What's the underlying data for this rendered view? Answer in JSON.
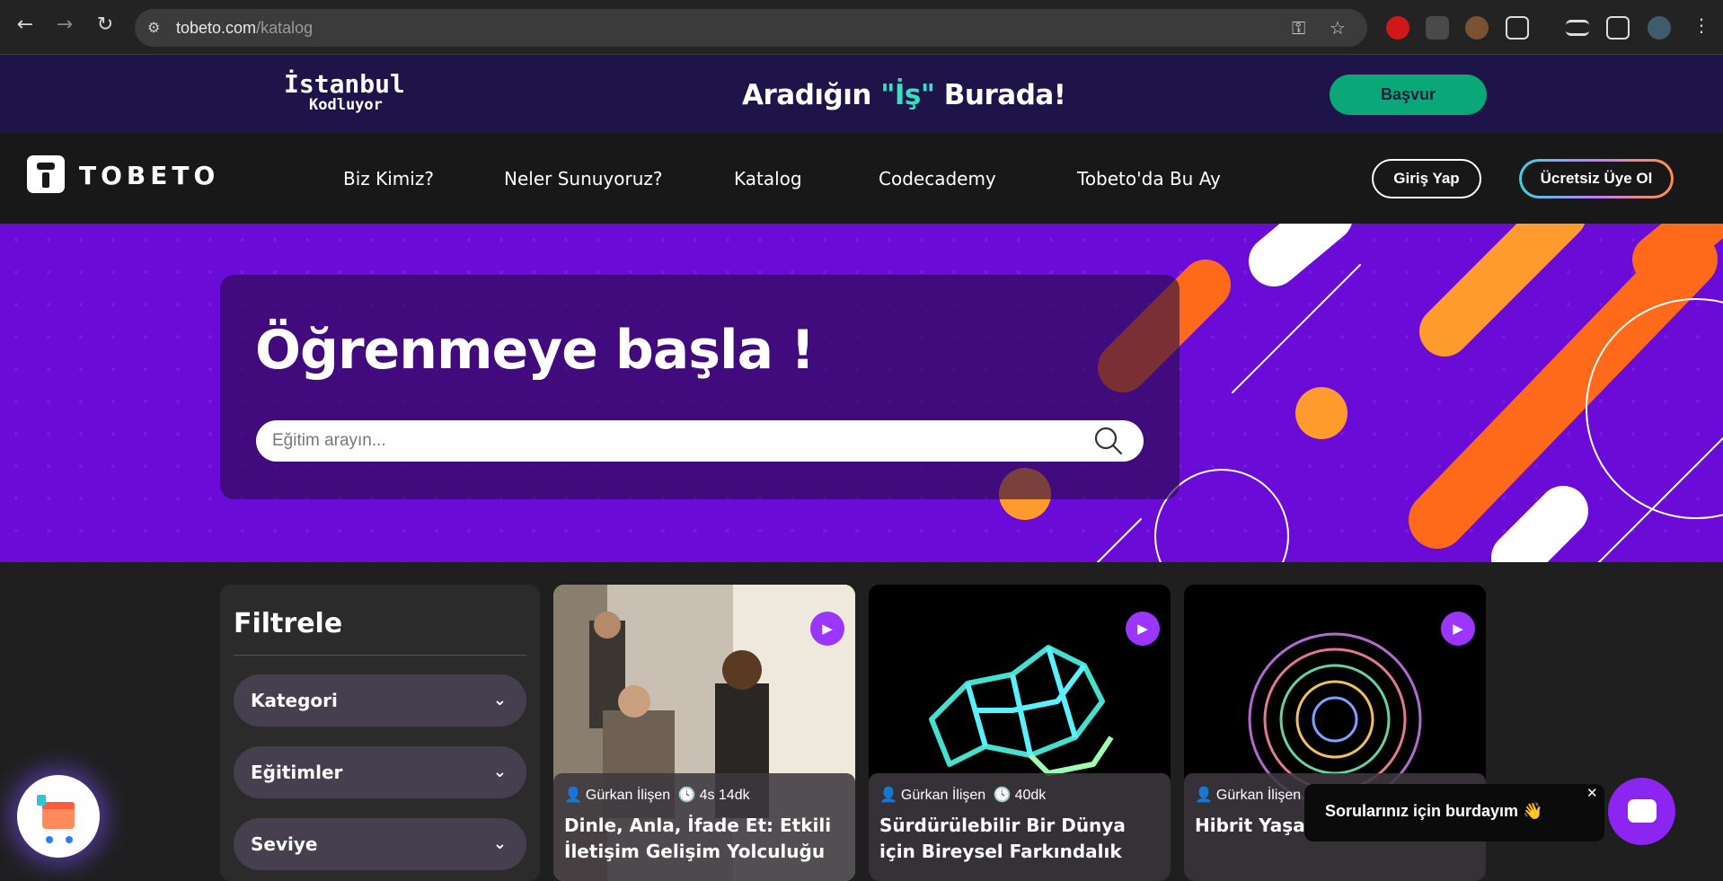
{
  "browser": {
    "url_host": "tobeto.com",
    "url_path": "/katalog",
    "back_icon": "arrow-left-icon",
    "forward_icon": "arrow-right-icon",
    "reload_icon": "reload-icon"
  },
  "banner": {
    "logo_top": "İstanbul",
    "logo_bottom": "Kodluyor",
    "headline_pre": "Aradığın ",
    "headline_quote": "\"İş\"",
    "headline_post": " Burada!",
    "apply_label": "Başvur"
  },
  "nav": {
    "brand": "TOBETO",
    "items": [
      "Biz Kimiz?",
      "Neler Sunuyoruz?",
      "Katalog",
      "Codecademy",
      "Tobeto'da Bu Ay"
    ],
    "login": "Giriş Yap",
    "signup": "Ücretsiz Üye Ol"
  },
  "hero": {
    "title": "Öğrenmeye başla !",
    "search_placeholder": "Eğitim arayın..."
  },
  "filter": {
    "title": "Filtrele",
    "items": [
      "Kategori",
      "Eğitimler",
      "Seviye"
    ]
  },
  "courses": [
    {
      "author": "Gürkan İlişen",
      "duration": "4s 14dk",
      "title": "Dinle, Anla, İfade Et: Etkili İletişim Gelişim Yolculuğu"
    },
    {
      "author": "Gürkan İlişen",
      "duration": "40dk",
      "title": "Sürdürülebilir Bir Dünya için Bireysel Farkındalık"
    },
    {
      "author": "Gürkan İlişen",
      "duration": "",
      "title": "Hibrit Yaşam Düzenleme"
    }
  ],
  "chat": {
    "message": "Sorularınız için burdayım 👋",
    "close": "✕"
  },
  "colors": {
    "banner_bg": "#1e1449",
    "hero_bg": "#6a0bd8",
    "accent_green": "#0aa878",
    "play_purple": "#9b35ff"
  }
}
